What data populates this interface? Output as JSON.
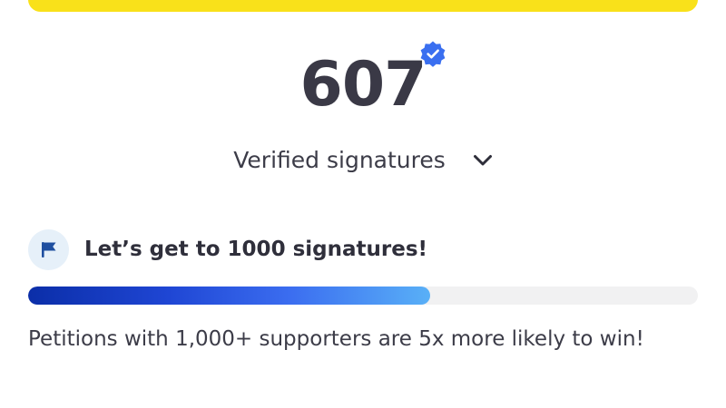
{
  "signatures": {
    "count": "607",
    "verified_label": "Verified signatures"
  },
  "milestone": {
    "title": "Let’s get to 1000 signatures!",
    "progress_fraction": 0.6,
    "hint": "Petitions with 1,000+ supporters are 5x more likely to win!"
  },
  "icons": {
    "verified": "verified-check-badge-icon",
    "chevron": "chevron-down-icon",
    "flag": "flag-icon"
  },
  "colors": {
    "top_bar": "#f9e11a",
    "count_text": "#3a3946",
    "badge": "#3a6ff0",
    "flag_bg": "#e6f0f9",
    "flag": "#1f4fa0",
    "progress_start": "#0b2ea8",
    "progress_end": "#59b0f7",
    "track": "#f1f1f2"
  }
}
